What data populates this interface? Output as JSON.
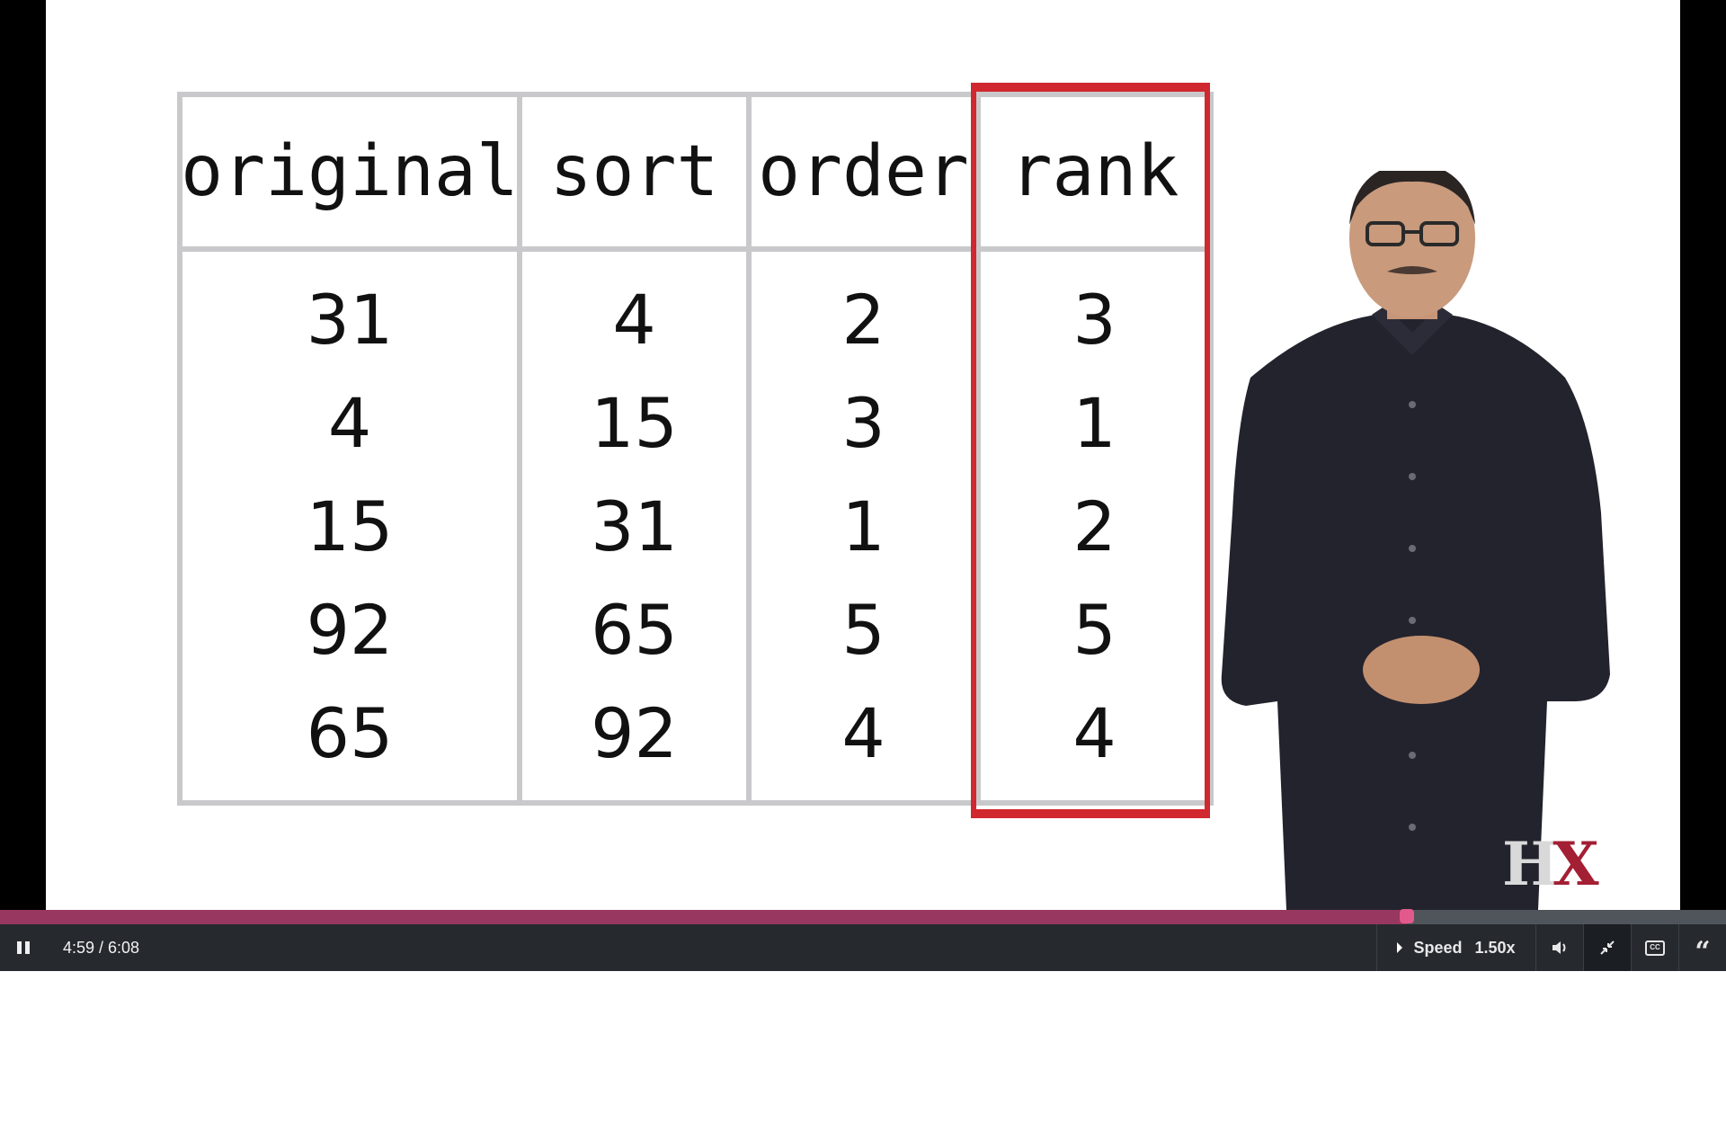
{
  "slide": {
    "table": {
      "headers": [
        "original",
        "sort",
        "order",
        "rank"
      ],
      "columns": [
        [
          "31",
          "4",
          "15",
          "92",
          "65"
        ],
        [
          "4",
          "15",
          "31",
          "65",
          "92"
        ],
        [
          "2",
          "3",
          "1",
          "5",
          "4"
        ],
        [
          "3",
          "1",
          "2",
          "5",
          "4"
        ]
      ]
    },
    "highlight_color": "#d0282e",
    "logo": {
      "h": "H",
      "x": "X",
      "h_color": "#d9d9d9",
      "x_color": "#a31f34"
    }
  },
  "player": {
    "progress_fraction": 0.815,
    "progress_color": "#98375f",
    "time_display": "4:59 / 6:08",
    "speed_label": "Speed",
    "speed_value": "1.50x",
    "icons": {
      "play_pause": "pause-icon",
      "volume": "volume-icon",
      "fullscreen": "exit-fullscreen-icon",
      "captions": "closed-captions-icon",
      "transcript": "transcript-quote-icon"
    }
  }
}
